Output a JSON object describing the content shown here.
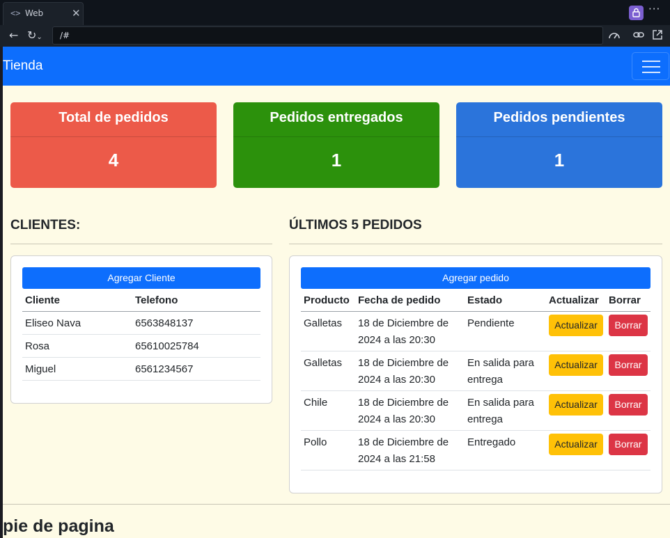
{
  "browser": {
    "tab_title": "Web",
    "url": "/#",
    "icons": [
      "code-icon",
      "close-icon",
      "lock-icon",
      "more-icon",
      "back-icon",
      "reload-icon",
      "performance-icon",
      "share-icon",
      "external-link-icon"
    ]
  },
  "navbar": {
    "brand": "Tienda"
  },
  "stats": [
    {
      "title": "Total de pedidos",
      "value": "4",
      "color": "#ec5a49"
    },
    {
      "title": "Pedidos entregados",
      "value": "1",
      "color": "#2c910c"
    },
    {
      "title": "Pedidos pendientes",
      "value": "1",
      "color": "#2b74db"
    }
  ],
  "clients": {
    "title": "CLIENTES:",
    "add_button": "Agregar Cliente",
    "headers": [
      "Cliente",
      "Telefono"
    ],
    "rows": [
      [
        "Eliseo Nava",
        "6563848137"
      ],
      [
        "Rosa",
        "65610025784"
      ],
      [
        "Miguel",
        "6561234567"
      ]
    ]
  },
  "orders": {
    "title": "ÚLTIMOS 5 PEDIDOS",
    "add_button": "Agregar pedido",
    "headers": [
      "Producto",
      "Fecha de pedido",
      "Estado",
      "Actualizar",
      "Borrar"
    ],
    "update_label": "Actualizar",
    "delete_label": "Borrar",
    "rows": [
      {
        "product": "Galletas",
        "date_line1": "18 de Diciembre de",
        "date_line2": "2024 a las 20:30",
        "status_line1": "Pendiente",
        "status_line2": ""
      },
      {
        "product": "Galletas",
        "date_line1": "18 de Diciembre de",
        "date_line2": "2024 a las 20:30",
        "status_line1": "En salida para",
        "status_line2": "entrega"
      },
      {
        "product": "Chile",
        "date_line1": "18 de Diciembre de",
        "date_line2": "2024 a las 20:30",
        "status_line1": "En salida para",
        "status_line2": "entrega"
      },
      {
        "product": "Pollo",
        "date_line1": "18 de Diciembre de",
        "date_line2": "2024 a las 21:58",
        "status_line1": "Entregado",
        "status_line2": ""
      }
    ]
  },
  "footer": {
    "text": "pie de pagina"
  }
}
